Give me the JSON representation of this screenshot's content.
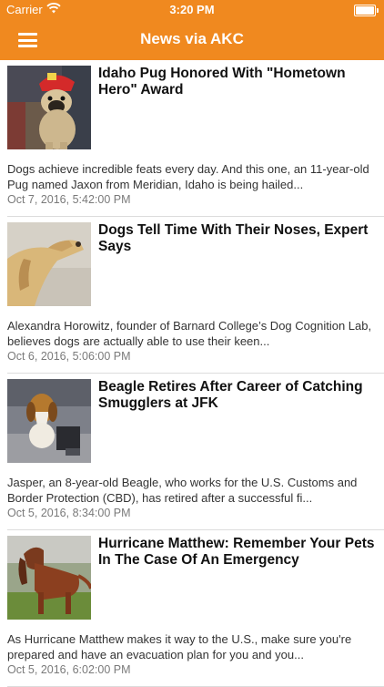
{
  "status": {
    "carrier": "Carrier",
    "time": "3:20 PM"
  },
  "nav": {
    "title": "News via AKC"
  },
  "articles": [
    {
      "title": "Idaho Pug Honored With \"Hometown Hero\" Award",
      "summary": "Dogs achieve incredible feats every day. And this one, an 11-year-old Pug named Jaxon from Meridian, Idaho is being hailed...",
      "date": "Oct 7, 2016, 5:42:00 PM"
    },
    {
      "title": "Dogs Tell Time With Their Noses, Expert Says",
      "summary": "Alexandra Horowitz, founder of Barnard College’s Dog Cognition Lab, believes dogs are actually able to use their keen...",
      "date": "Oct 6, 2016, 5:06:00 PM"
    },
    {
      "title": "Beagle Retires After Career of Catching Smugglers at JFK",
      "summary": "Jasper, an 8-year-old Beagle, who works for the U.S. Customs and Border Protection (CBD), has retired after a successful fi...",
      "date": "Oct 5, 2016, 8:34:00 PM"
    },
    {
      "title": "Hurricane Matthew: Remember Your Pets In The Case Of An Emergency",
      "summary": "As Hurricane Matthew makes it way to the U.S., make sure you're prepared and have an evacuation plan for you and you...",
      "date": "Oct 5, 2016, 6:02:00 PM"
    }
  ]
}
